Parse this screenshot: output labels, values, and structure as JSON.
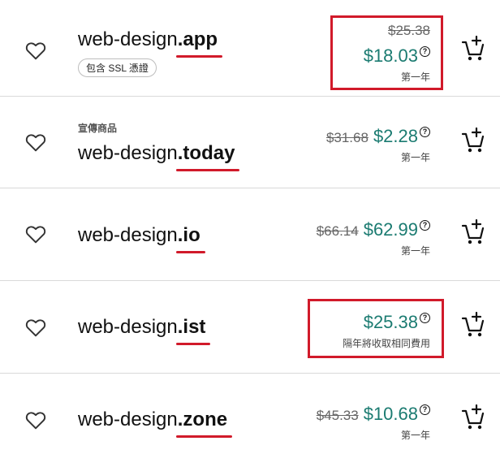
{
  "rows": [
    {
      "sld": "web-design",
      "tld": ".app",
      "badge": "包含 SSL 憑證",
      "promo": "",
      "old_price": "$25.38",
      "new_price": "$18.03",
      "term": "第一年",
      "highlighted": true
    },
    {
      "sld": "web-design",
      "tld": ".today",
      "badge": "",
      "promo": "宣傳商品",
      "old_price": "$31.68",
      "new_price": "$2.28",
      "term": "第一年",
      "highlighted": false
    },
    {
      "sld": "web-design",
      "tld": ".io",
      "badge": "",
      "promo": "",
      "old_price": "$66.14",
      "new_price": "$62.99",
      "term": "第一年",
      "highlighted": false
    },
    {
      "sld": "web-design",
      "tld": ".ist",
      "badge": "",
      "promo": "",
      "old_price": "",
      "new_price": "$25.38",
      "term": "隔年將收取相同費用",
      "highlighted": true
    },
    {
      "sld": "web-design",
      "tld": ".zone",
      "badge": "",
      "promo": "",
      "old_price": "$45.33",
      "new_price": "$10.68",
      "term": "第一年",
      "highlighted": false
    }
  ],
  "icons": {
    "favorite": "heart-outline-icon",
    "info": "question-circle-icon",
    "add_to_cart": "cart-plus-icon"
  },
  "colors": {
    "price": "#1b7b71",
    "highlight": "#d11a2a",
    "underline": "#d11a2a"
  }
}
